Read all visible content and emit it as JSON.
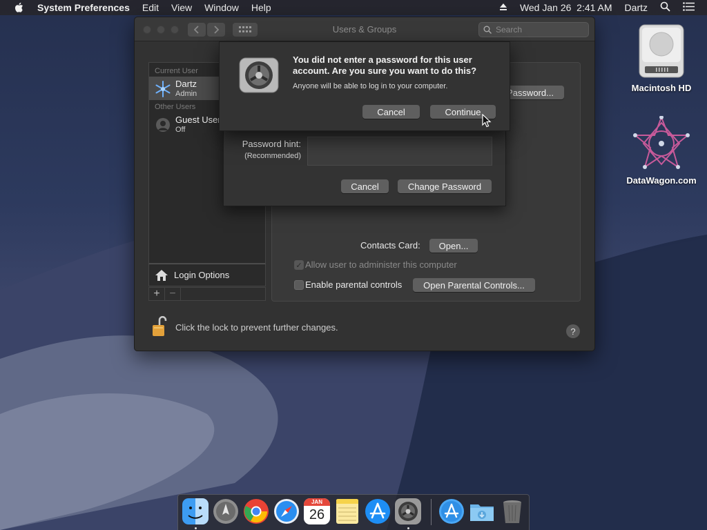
{
  "menubar": {
    "app_name": "System Preferences",
    "menus": [
      "Edit",
      "View",
      "Window",
      "Help"
    ],
    "date_time": "Wed Jan 26  2:41 AM",
    "user": "Dartz"
  },
  "window": {
    "title": "Users & Groups",
    "search_placeholder": "Search"
  },
  "sidebar": {
    "current_users_header": "Current User",
    "current_user": {
      "name": "Dartz",
      "role": "Admin"
    },
    "other_users_header": "Other Users",
    "other_user": {
      "name": "Guest User",
      "status": "Off"
    },
    "login_options_label": "Login Options",
    "add_label": "+",
    "remove_label": "−"
  },
  "panel": {
    "change_password_label": "Password...",
    "contacts_card_label": "Contacts Card:",
    "open_button": "Open...",
    "allow_admin_label": "Allow user to administer this computer",
    "parental_controls_label": "Enable parental controls",
    "open_parental_button": "Open Parental Controls...",
    "lock_text": "Click the lock to prevent further changes.",
    "help_label": "?"
  },
  "password_sheet": {
    "hint_label": "Password hint:",
    "hint_sub": "(Recommended)",
    "cancel_button": "Cancel",
    "change_button": "Change Password"
  },
  "alert": {
    "message": "You did not enter a password for this user account. Are you sure you want to do this?",
    "info": "Anyone will be able to log in to your computer.",
    "cancel_button": "Cancel",
    "continue_button": "Continue"
  },
  "desktop": {
    "icons": [
      {
        "label": "Macintosh HD",
        "icon": "hard-drive-icon"
      },
      {
        "label": "DataWagon.com",
        "icon": "datawagon-icon"
      }
    ]
  },
  "dock": {
    "apps": [
      "Finder",
      "Launchpad",
      "Chrome",
      "Safari",
      "Calendar",
      "Notes",
      "App Store",
      "System Preferences",
      "Applications",
      "Downloads",
      "Trash"
    ],
    "calendar_month": "JAN",
    "calendar_day": "26"
  },
  "colors": {
    "window_bg": "#323232",
    "panel_bg": "#393939",
    "button_bg": "#5f5f5f",
    "desktop_bg": "#25304f"
  }
}
